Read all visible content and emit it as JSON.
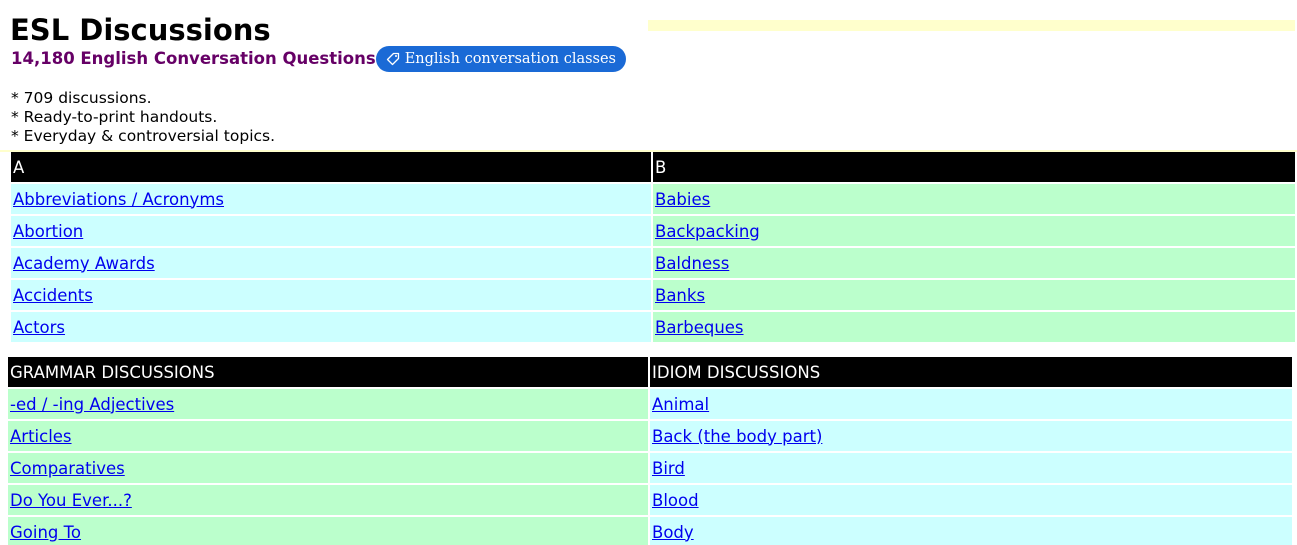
{
  "header": {
    "title": "ESL Discussions",
    "subtitle": "14,180 English Conversation Questions",
    "pill_label": "English conversation classes"
  },
  "bullets": [
    "* 709 discussions.",
    "* Ready-to-print handouts.",
    "* Everyday & controversial topics."
  ],
  "colors": {
    "header_bg": "#000000",
    "cyan_row": "#ccffff",
    "green_row": "#bbffcc",
    "link": "#0000ee",
    "subtitle": "#660066",
    "pill": "#1a6ad6",
    "strip": "#ffffcc"
  },
  "section_a": {
    "header": "A",
    "items": [
      "Abbreviations / Acronyms",
      "Abortion",
      "Academy Awards",
      "Accidents",
      "Actors"
    ]
  },
  "section_b": {
    "header": "B",
    "items": [
      "Babies",
      "Backpacking",
      "Baldness",
      "Banks",
      "Barbeques"
    ]
  },
  "grammar": {
    "header": "GRAMMAR DISCUSSIONS",
    "items": [
      "-ed / -ing Adjectives",
      "Articles",
      "Comparatives",
      "Do You Ever...?",
      "Going To"
    ]
  },
  "idiom": {
    "header": "IDIOM DISCUSSIONS",
    "items": [
      "Animal",
      "Back (the body part)",
      "Bird",
      "Blood",
      "Body"
    ]
  }
}
